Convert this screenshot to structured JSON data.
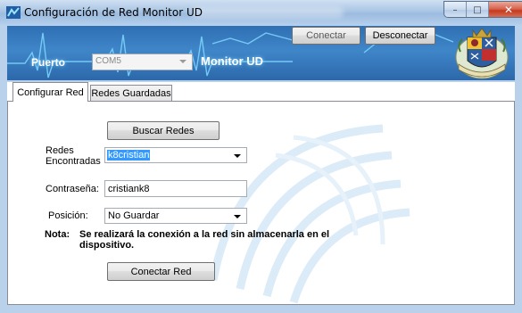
{
  "window": {
    "title": "Configuración de Red Monitor UD",
    "controls": {
      "minimize": "–",
      "maximize": "□",
      "close": "✕"
    }
  },
  "header": {
    "port_label": "Puerto",
    "port_value": "COM5",
    "app_name": "Monitor UD",
    "connect_label": "Conectar",
    "disconnect_label": "Desconectar",
    "logo_icon": "university-crest-icon"
  },
  "tabs": [
    {
      "label": "Configurar Red",
      "active": true
    },
    {
      "label": "Redes Guardadas",
      "active": false
    }
  ],
  "config": {
    "search_button": "Buscar Redes",
    "networks_label": "Redes Encontradas",
    "networks_value": "k8cristian",
    "password_label": "Contraseña:",
    "password_value": "cristiank8",
    "position_label": "Posición:",
    "position_value": "No Guardar",
    "note_label": "Nota:",
    "note_text": "Se realizará la conexión a la red sin almacenarla en el dispositivo.",
    "connect_network_button": "Conectar Red"
  },
  "colors": {
    "banner": "#3f86c9",
    "selection": "#3399ff",
    "titlebar": "#a9c5e4"
  }
}
